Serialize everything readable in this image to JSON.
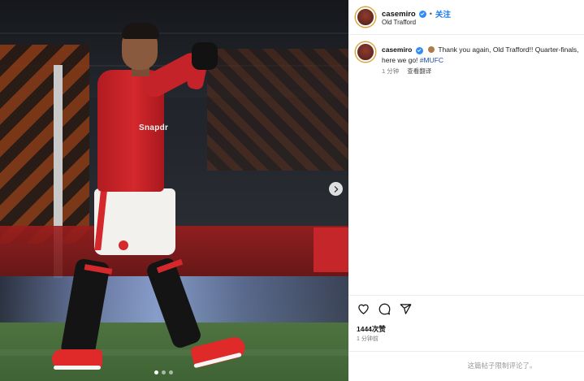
{
  "post": {
    "username": "casemiro",
    "follow_label": "关注",
    "location": "Old Trafford",
    "separator": "•",
    "caption": {
      "username": "casemiro",
      "text": "Thank you again, Old Trafford!! Quarter-finals, here we go!",
      "hashtag": "#MUFC"
    },
    "caption_time": "1 分钟",
    "see_translation": "查看翻译",
    "likes": "1444次赞",
    "time_ago": "1 分钟前",
    "comments_disabled": "这篇帖子限制评论了。"
  },
  "photo": {
    "sponsor_text": "Snapdr",
    "carousel_dots": 3,
    "active_dot": 0
  },
  "icons": {
    "like": "heart-icon",
    "comment": "comment-icon",
    "share": "send-icon",
    "verified": "verified-badge-icon",
    "next": "chevron-right-icon"
  },
  "colors": {
    "accent_blue": "#1677f2",
    "verified_blue": "#2f8cf5",
    "hashtag": "#1f4fa8",
    "jersey_red": "#d4282c"
  }
}
